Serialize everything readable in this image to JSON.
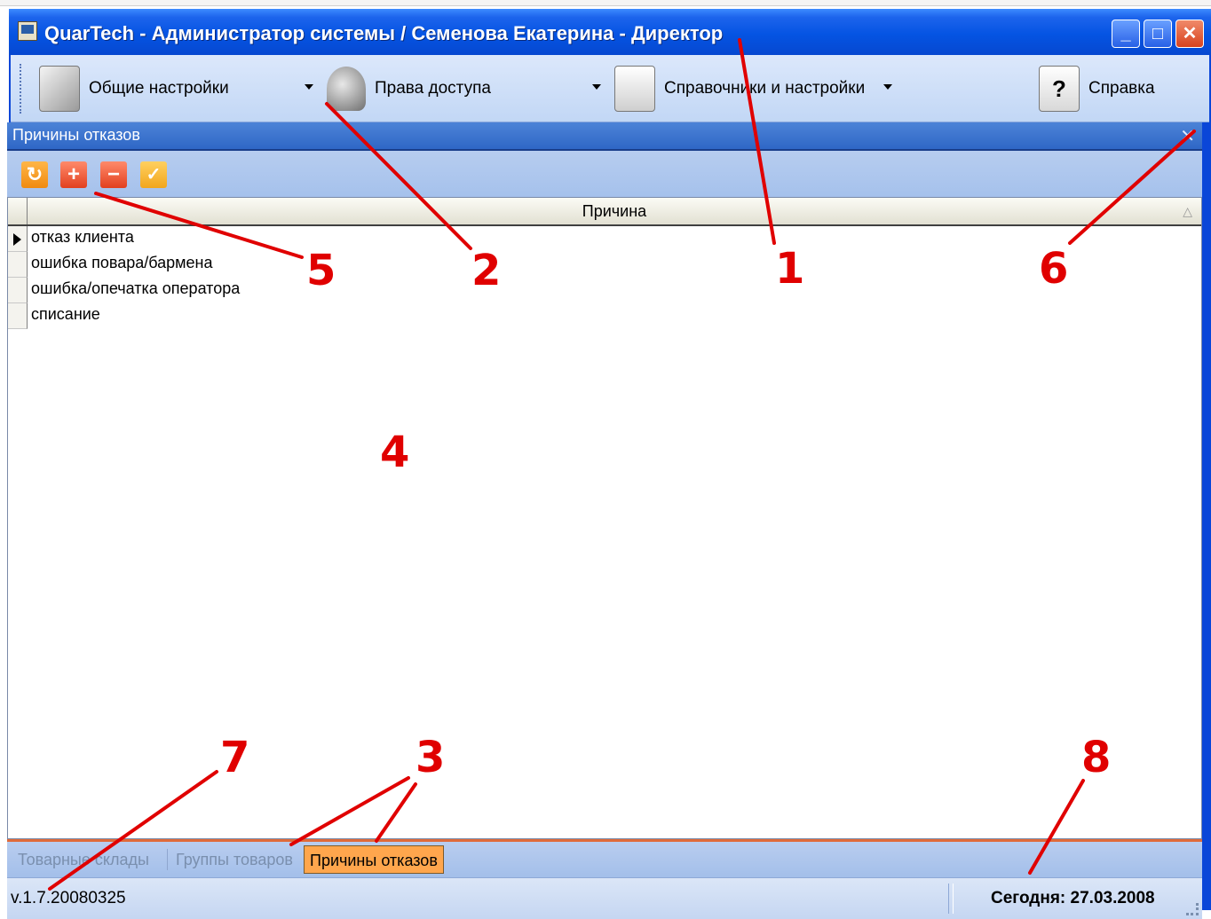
{
  "window": {
    "title": "QuarTech - Администратор системы / Семенова Екатерина - Директор",
    "minimize": "_",
    "maximize": "□",
    "close": "✕"
  },
  "toolbar": {
    "general_settings": "Общие настройки",
    "access_rights": "Права доступа",
    "references_settings": "Справочники и настройки",
    "help": "Справка"
  },
  "panel": {
    "title": "Причины отказов",
    "close": "✕"
  },
  "grid": {
    "column_header": "Причина",
    "sort_indicator": "△",
    "rows": [
      "отказ клиента",
      "ошибка повара/бармена",
      "ошибка/опечатка оператора",
      "списание"
    ]
  },
  "grid_toolbar": {
    "refresh": "↻",
    "add": "+",
    "delete": "−",
    "apply": "✓"
  },
  "tabs": [
    "Товарные склады",
    "Группы товаров",
    "Причины отказов"
  ],
  "active_tab": 2,
  "status": {
    "version": "v.1.7.20080325",
    "today": "Сегодня: 27.03.2008"
  },
  "annotations": [
    "1",
    "2",
    "3",
    "4",
    "5",
    "6",
    "7",
    "8"
  ],
  "colors": {
    "annotation": "#e00000",
    "title_bar": "#0554e3",
    "active_tab": "#ffa64d"
  }
}
